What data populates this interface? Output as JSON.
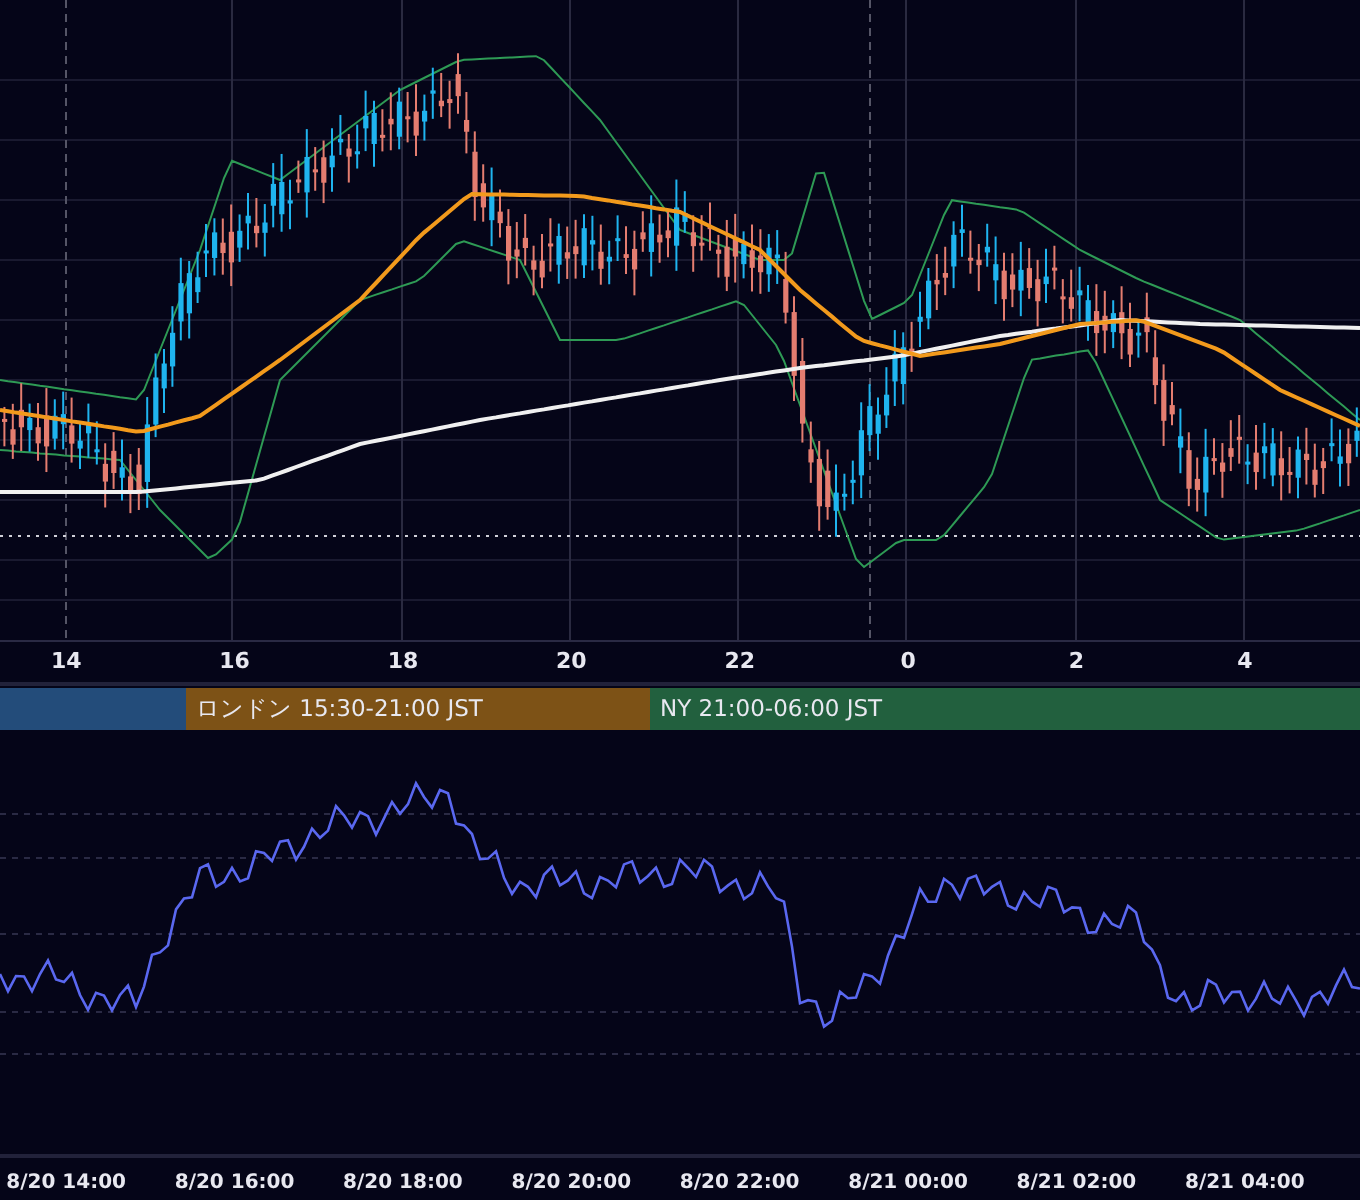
{
  "price_chart": {
    "hour_labels": [
      "14",
      "16",
      "18",
      "20",
      "22",
      "0",
      "2",
      "4"
    ]
  },
  "sessions": [
    {
      "color": "#234c7a"
    },
    {
      "label": "ロンドン 15:30-21:00 JST",
      "color": "#7d5216"
    },
    {
      "label": "NY 21:00-06:00 JST",
      "color": "#22603e"
    }
  ],
  "oscillator": {
    "time_labels": [
      "8/20 14:00",
      "8/20 16:00",
      "8/20 18:00",
      "8/20 20:00",
      "8/20 22:00",
      "8/21 00:00",
      "8/21 02:00",
      "8/21 04:00"
    ]
  }
}
